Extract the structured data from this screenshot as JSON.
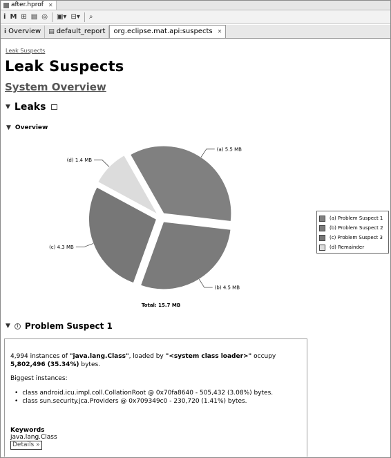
{
  "editor": {
    "file_tab": "after.hprof"
  },
  "subtabs": [
    "Overview",
    "default_report",
    "org.eclipse.mat.api:suspects"
  ],
  "report": {
    "breadcrumb": "Leak Suspects",
    "title": "Leak Suspects",
    "system_overview_link": "System Overview",
    "leaks_heading": "Leaks",
    "overview_heading": "Overview"
  },
  "chart_data": {
    "type": "pie",
    "title": "",
    "total_label": "Total: 15.7 MB",
    "slices": [
      {
        "key": "a",
        "label": "(a)  5.5 MB",
        "value": 5.5,
        "color": "#808080",
        "legend": "(a)  Problem Suspect 1"
      },
      {
        "key": "b",
        "label": "(b)  4.5 MB",
        "value": 4.5,
        "color": "#7b7b7b",
        "legend": "(b)  Problem Suspect 2"
      },
      {
        "key": "c",
        "label": "(c)  4.3 MB",
        "value": 4.3,
        "color": "#777777",
        "legend": "(c)  Problem Suspect 3"
      },
      {
        "key": "d",
        "label": "(d)  1.4 MB",
        "value": 1.4,
        "color": "#dcdcdc",
        "legend": "(d)  Remainder"
      }
    ],
    "legend_position": "right"
  },
  "suspect": {
    "heading": "Problem Suspect 1",
    "line1_a": "4,994 instances of ",
    "class_name": "\"java.lang.Class\"",
    "line1_b": ", loaded by ",
    "loader": "\"<system class loader>\"",
    "line1_c": " occupy",
    "bytes_bold": "5,802,496 (35.34%)",
    "bytes_tail": " bytes.",
    "biggest_label": "Biggest instances:",
    "instances": [
      "class android.icu.impl.coll.CollationRoot @ 0x70fa8640 - 505,432 (3.08%) bytes.",
      "class sun.security.jca.Providers @ 0x709349c0 - 230,720 (1.41%) bytes."
    ],
    "keywords_label": "Keywords",
    "keyword": "java.lang.Class",
    "details_link": "Details »"
  }
}
